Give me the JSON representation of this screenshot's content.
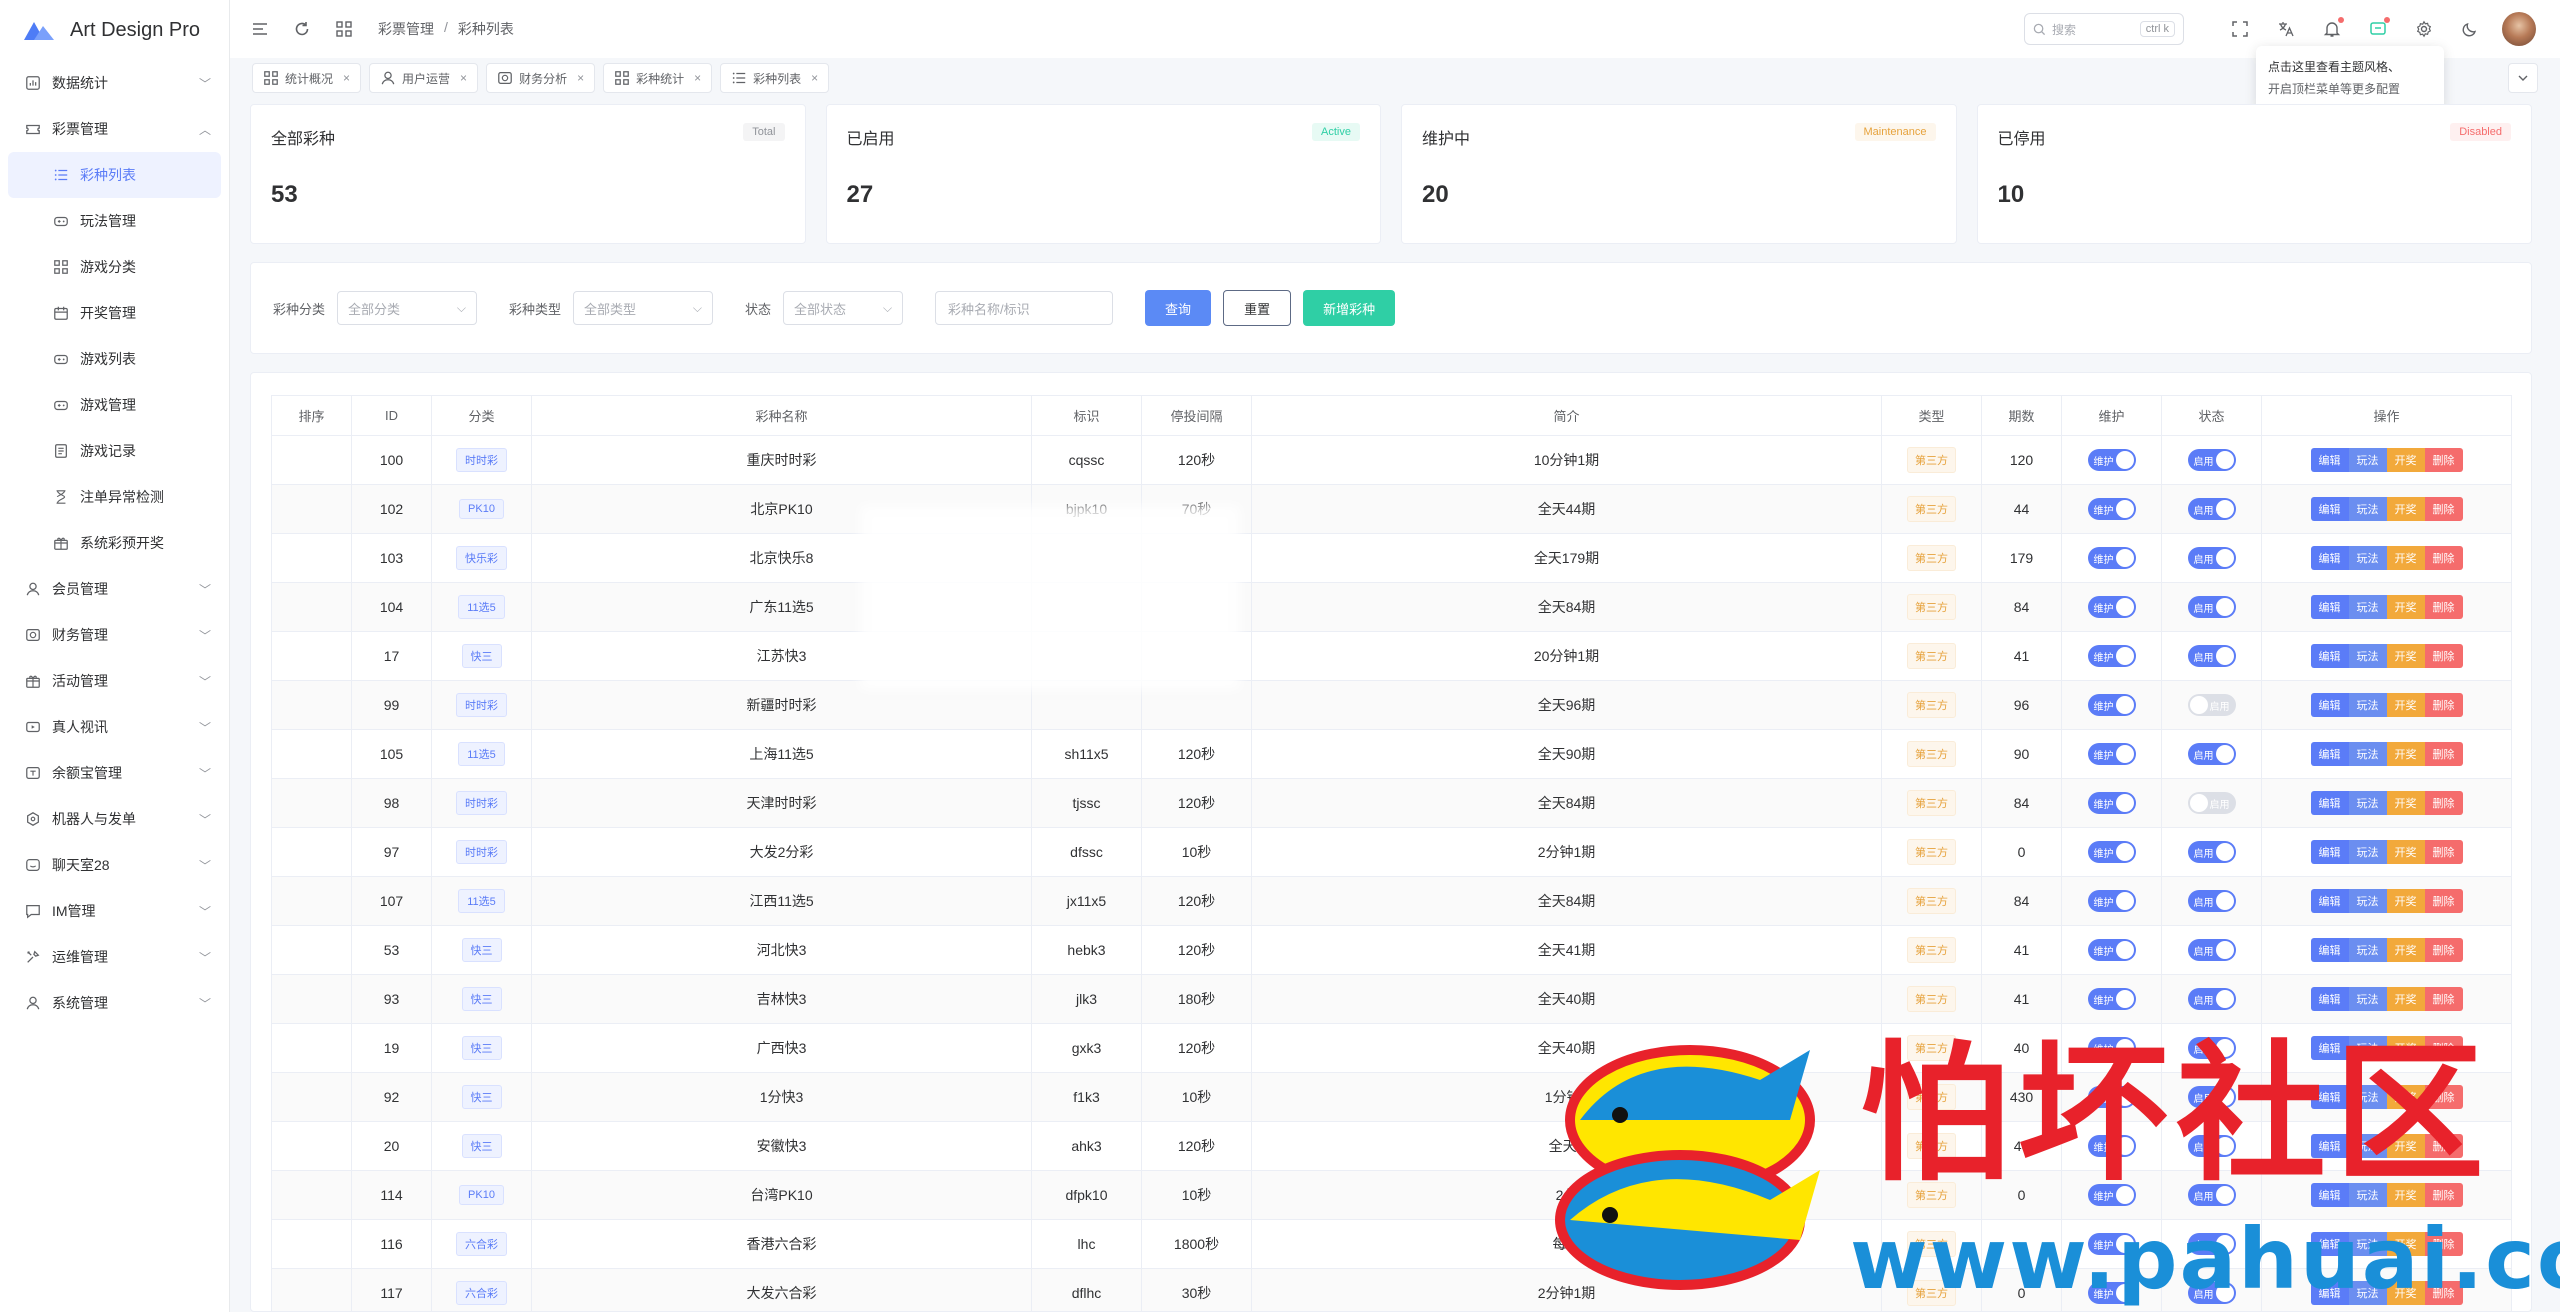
{
  "app": {
    "title": "Art Design Pro"
  },
  "sidebar": {
    "items": [
      {
        "label": "数据统计",
        "icon": "chart-icon",
        "expanded": false
      },
      {
        "label": "彩票管理",
        "icon": "lottery-icon",
        "expanded": true,
        "children": [
          {
            "label": "彩种列表",
            "icon": "list-icon",
            "active": true
          },
          {
            "label": "玩法管理",
            "icon": "gamepad-icon"
          },
          {
            "label": "游戏分类",
            "icon": "grid-icon"
          },
          {
            "label": "开奖管理",
            "icon": "calendar-icon"
          },
          {
            "label": "游戏列表",
            "icon": "gamepad-icon"
          },
          {
            "label": "游戏管理",
            "icon": "gamepad-icon"
          },
          {
            "label": "游戏记录",
            "icon": "record-icon"
          },
          {
            "label": "注单异常检测",
            "icon": "hourglass-icon"
          },
          {
            "label": "系统彩预开奖",
            "icon": "gift-icon"
          }
        ]
      },
      {
        "label": "会员管理",
        "icon": "user-icon",
        "expanded": false
      },
      {
        "label": "财务管理",
        "icon": "finance-icon",
        "expanded": false
      },
      {
        "label": "活动管理",
        "icon": "gift-icon",
        "expanded": false
      },
      {
        "label": "真人视讯",
        "icon": "video-icon",
        "expanded": false
      },
      {
        "label": "余额宝管理",
        "icon": "wallet-icon",
        "expanded": false
      },
      {
        "label": "机器人与发单",
        "icon": "robot-icon",
        "expanded": false
      },
      {
        "label": "聊天室28",
        "icon": "chatroom-icon",
        "expanded": false
      },
      {
        "label": "IM管理",
        "icon": "message-icon",
        "expanded": false
      },
      {
        "label": "运维管理",
        "icon": "tools-icon",
        "expanded": false
      },
      {
        "label": "系统管理",
        "icon": "user-icon",
        "expanded": false
      }
    ]
  },
  "header": {
    "breadcrumb": [
      "彩票管理",
      "彩种列表"
    ],
    "search_placeholder": "搜索",
    "search_shortcut": "ctrl k"
  },
  "tabs": [
    {
      "label": "统计概况"
    },
    {
      "label": "用户运营"
    },
    {
      "label": "财务分析"
    },
    {
      "label": "彩种统计"
    },
    {
      "label": "彩种列表",
      "active": true
    }
  ],
  "tooltip": {
    "line1": "点击这里查看主题风格、",
    "line2": "开启顶栏菜单等更多配置"
  },
  "stats": [
    {
      "title": "全部彩种",
      "badge": "Total",
      "value": "53",
      "badge_color": "#909399",
      "badge_bg": "#f4f4f5"
    },
    {
      "title": "已启用",
      "badge": "Active",
      "value": "27",
      "badge_color": "#2fcfa5",
      "badge_bg": "#e7faf4"
    },
    {
      "title": "维护中",
      "badge": "Maintenance",
      "value": "20",
      "badge_color": "#e6a23c",
      "badge_bg": "#fdf6ec"
    },
    {
      "title": "已停用",
      "badge": "Disabled",
      "value": "10",
      "badge_color": "#f56c6c",
      "badge_bg": "#fef0f0"
    }
  ],
  "filters": {
    "category_label": "彩种分类",
    "category_value": "全部分类",
    "type_label": "彩种类型",
    "type_value": "全部类型",
    "status_label": "状态",
    "status_value": "全部状态",
    "keyword_placeholder": "彩种名称/标识",
    "query_btn": "查询",
    "reset_btn": "重置",
    "add_btn": "新增彩种"
  },
  "table": {
    "columns": [
      "排序",
      "ID",
      "分类",
      "彩种名称",
      "标识",
      "停投间隔",
      "简介",
      "类型",
      "期数",
      "维护",
      "状态",
      "操作"
    ],
    "switch_maint_label": "维护",
    "switch_status_label": "启用",
    "ops": {
      "edit": "编辑",
      "play": "玩法",
      "draw": "开奖",
      "del": "删除"
    },
    "rows": [
      {
        "id": "100",
        "cat": "时时彩",
        "name": "重庆时时彩",
        "code": "cqssc",
        "interval": "120秒",
        "desc": "10分钟1期",
        "type": "第三方",
        "periods": "120",
        "maint": true,
        "status": true
      },
      {
        "id": "102",
        "cat": "PK10",
        "name": "北京PK10",
        "code": "bjpk10",
        "interval": "70秒",
        "desc": "全天44期",
        "type": "第三方",
        "periods": "44",
        "maint": true,
        "status": true
      },
      {
        "id": "103",
        "cat": "快乐彩",
        "name": "北京快乐8",
        "code": "",
        "interval": "",
        "desc": "全天179期",
        "type": "第三方",
        "periods": "179",
        "maint": true,
        "status": true
      },
      {
        "id": "104",
        "cat": "11选5",
        "name": "广东11选5",
        "code": "",
        "interval": "",
        "desc": "全天84期",
        "type": "第三方",
        "periods": "84",
        "maint": true,
        "status": true
      },
      {
        "id": "17",
        "cat": "快三",
        "name": "江苏快3",
        "code": "",
        "interval": "",
        "desc": "20分钟1期",
        "type": "第三方",
        "periods": "41",
        "maint": true,
        "status": true
      },
      {
        "id": "99",
        "cat": "时时彩",
        "name": "新疆时时彩",
        "code": "",
        "interval": "",
        "desc": "全天96期",
        "type": "第三方",
        "periods": "96",
        "maint": true,
        "status": false
      },
      {
        "id": "105",
        "cat": "11选5",
        "name": "上海11选5",
        "code": "sh11x5",
        "interval": "120秒",
        "desc": "全天90期",
        "type": "第三方",
        "periods": "90",
        "maint": true,
        "status": true
      },
      {
        "id": "98",
        "cat": "时时彩",
        "name": "天津时时彩",
        "code": "tjssc",
        "interval": "120秒",
        "desc": "全天84期",
        "type": "第三方",
        "periods": "84",
        "maint": true,
        "status": false
      },
      {
        "id": "97",
        "cat": "时时彩",
        "name": "大发2分彩",
        "code": "dfssc",
        "interval": "10秒",
        "desc": "2分钟1期",
        "type": "第三方",
        "periods": "0",
        "maint": true,
        "status": true
      },
      {
        "id": "107",
        "cat": "11选5",
        "name": "江西11选5",
        "code": "jx11x5",
        "interval": "120秒",
        "desc": "全天84期",
        "type": "第三方",
        "periods": "84",
        "maint": true,
        "status": true
      },
      {
        "id": "53",
        "cat": "快三",
        "name": "河北快3",
        "code": "hebk3",
        "interval": "120秒",
        "desc": "全天41期",
        "type": "第三方",
        "periods": "41",
        "maint": true,
        "status": true
      },
      {
        "id": "93",
        "cat": "快三",
        "name": "吉林快3",
        "code": "jlk3",
        "interval": "180秒",
        "desc": "全天40期",
        "type": "第三方",
        "periods": "41",
        "maint": true,
        "status": true
      },
      {
        "id": "19",
        "cat": "快三",
        "name": "广西快3",
        "code": "gxk3",
        "interval": "120秒",
        "desc": "全天40期",
        "type": "第三方",
        "periods": "40",
        "maint": true,
        "status": true
      },
      {
        "id": "92",
        "cat": "快三",
        "name": "1分快3",
        "code": "f1k3",
        "interval": "10秒",
        "desc": "1分钟1",
        "type": "第三方",
        "periods": "430",
        "maint": true,
        "status": true
      },
      {
        "id": "20",
        "cat": "快三",
        "name": "安徽快3",
        "code": "ahk3",
        "interval": "120秒",
        "desc": "全天4",
        "type": "第三方",
        "periods": "40",
        "maint": true,
        "status": true
      },
      {
        "id": "114",
        "cat": "PK10",
        "name": "台湾PK10",
        "code": "dfpk10",
        "interval": "10秒",
        "desc": "2分",
        "type": "第三方",
        "periods": "0",
        "maint": true,
        "status": true
      },
      {
        "id": "116",
        "cat": "六合彩",
        "name": "香港六合彩",
        "code": "lhc",
        "interval": "1800秒",
        "desc": "每周",
        "type": "第三方",
        "periods": "",
        "maint": true,
        "status": true
      },
      {
        "id": "117",
        "cat": "六合彩",
        "name": "大发六合彩",
        "code": "dflhc",
        "interval": "30秒",
        "desc": "2分钟1期",
        "type": "第三方",
        "periods": "0",
        "maint": true,
        "status": true
      }
    ]
  },
  "watermark": {
    "text": "怕坏社区",
    "url": "www.pahuai.com"
  }
}
